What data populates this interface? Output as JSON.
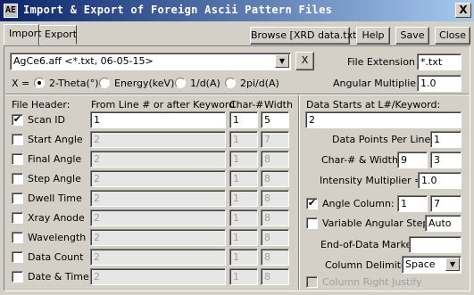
{
  "window": {
    "icon_text": "AE",
    "title": "Import & Export of Foreign Ascii Pattern Files",
    "close_glyph": "X"
  },
  "tabs": [
    {
      "label": "Import",
      "active": true
    },
    {
      "label": "Export",
      "active": false
    }
  ],
  "toolbar": {
    "browse_label": "Browse [XRD data.txt]",
    "help_label": "Help",
    "save_label": "Save",
    "close_label": "Close"
  },
  "format_select": {
    "value": "AgCe6.aff <*.txt, 06-05-15>",
    "arrow": "▼",
    "clear_glyph": "X"
  },
  "file_extension": {
    "label": "File Extension =",
    "value": "*.txt"
  },
  "x_axis": {
    "label": "X =",
    "options": [
      {
        "label": "2-Theta(°)",
        "selected": true
      },
      {
        "label": "Energy(keV)",
        "selected": false
      },
      {
        "label": "1/d(A)",
        "selected": false
      },
      {
        "label": "2pi/d(A)",
        "selected": false
      }
    ]
  },
  "angular_multiplier": {
    "label": "Angular Multiplier =",
    "value": "1.0"
  },
  "header_table": {
    "col_file_header": "File Header:",
    "col_from_line": "From Line # or after Keyword",
    "col_char": "Char-#",
    "col_width": "Width",
    "rows": [
      {
        "label": "Scan ID",
        "checked": true,
        "keyword": "1",
        "char": "1",
        "width": "5",
        "enabled": true
      },
      {
        "label": "Start Angle",
        "checked": false,
        "keyword": "2",
        "char": "1",
        "width": "7",
        "enabled": false
      },
      {
        "label": "Final Angle",
        "checked": false,
        "keyword": "2",
        "char": "1",
        "width": "8",
        "enabled": false
      },
      {
        "label": "Step Angle",
        "checked": false,
        "keyword": "2",
        "char": "1",
        "width": "8",
        "enabled": false
      },
      {
        "label": "Dwell Time",
        "checked": false,
        "keyword": "2",
        "char": "1",
        "width": "8",
        "enabled": false
      },
      {
        "label": "Xray Anode",
        "checked": false,
        "keyword": "2",
        "char": "1",
        "width": "8",
        "enabled": false
      },
      {
        "label": "Wavelength",
        "checked": false,
        "keyword": "2",
        "char": "1",
        "width": "8",
        "enabled": false
      },
      {
        "label": "Data Count",
        "checked": false,
        "keyword": "2",
        "char": "1",
        "width": "8",
        "enabled": false
      },
      {
        "label": "Date & Time",
        "checked": false,
        "keyword": "2",
        "char": "1",
        "width": "8",
        "enabled": false
      }
    ]
  },
  "data_settings": {
    "data_starts_label": "Data Starts at L#/Keyword:",
    "data_starts_value": "2",
    "points_per_line_label": "Data Points Per Line =",
    "points_per_line_value": "1",
    "char_width_label": "Char-# & Width =",
    "char_value": "9",
    "width_value": "3",
    "intensity_multiplier_label": "Intensity Multiplier =",
    "intensity_multiplier_value": "1.0",
    "angle_column_label": "Angle Column:",
    "angle_column_checked": true,
    "angle_column_char": "1",
    "angle_column_width": "7",
    "variable_steps_label": "Variable Angular Steps:",
    "variable_steps_checked": false,
    "variable_steps_value": "Auto",
    "end_marker_label": "End-of-Data Marker:",
    "end_marker_value": "",
    "column_delimiter_label": "Column Delimiter:",
    "column_delimiter_value": "Space",
    "column_right_justify_label": "Column Right Justify",
    "column_right_justify_checked": false
  },
  "check_glyph": "✔"
}
